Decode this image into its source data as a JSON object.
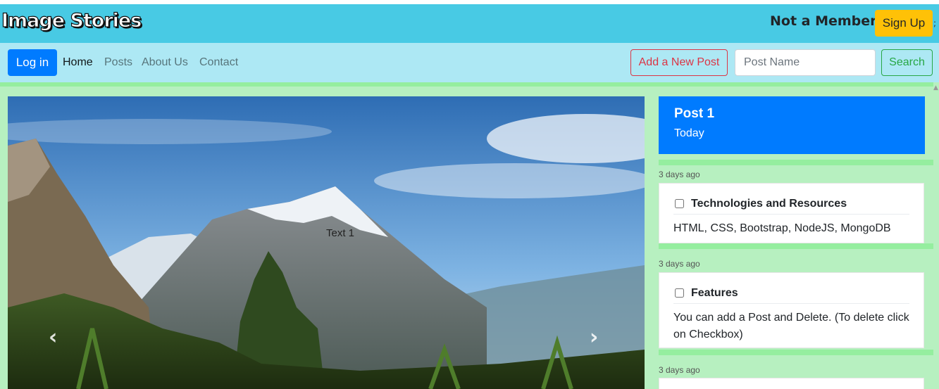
{
  "header": {
    "logo": "Image Stories",
    "member_text": "Not a Member",
    "signup_label": "Sign Up"
  },
  "nav": {
    "login_label": "Log in",
    "links": [
      "Home",
      "Posts",
      "About Us",
      "Contact"
    ],
    "add_post_label": "Add a New Post",
    "search_placeholder": "Post Name",
    "search_label": "Search"
  },
  "carousel": {
    "caption": "Text 1",
    "prev_icon": "chevron-left",
    "next_icon": "chevron-right"
  },
  "sidebar": {
    "featured": {
      "title": "Post 1",
      "date": "Today"
    },
    "posts": [
      {
        "ago": "3 days ago",
        "title": "Technologies and Resources",
        "body": "HTML, CSS, Bootstrap, NodeJS, MongoDB"
      },
      {
        "ago": "3 days ago",
        "title": "Features",
        "body": "You can add a Post and Delete. (To delete click on Checkbox)"
      },
      {
        "ago": "3 days ago"
      }
    ]
  },
  "colors": {
    "header_bg": "#48cae4",
    "nav_bg": "#ade8f4",
    "main_bg": "#b7f0c0",
    "primary": "#007bff",
    "warning": "#ffc107",
    "danger": "#dc3545",
    "success": "#28a745"
  }
}
